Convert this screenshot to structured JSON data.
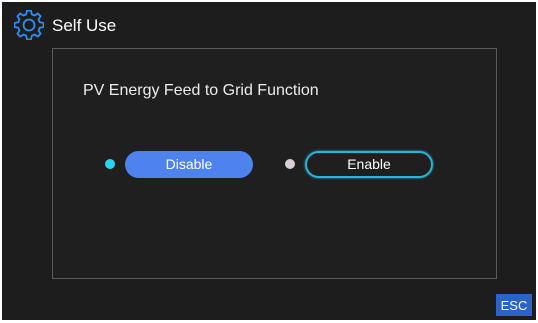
{
  "header": {
    "title": "Self Use",
    "icon": "gear-icon"
  },
  "panel": {
    "heading": "PV Energy Feed to Grid Function",
    "options": [
      {
        "label": "Disable",
        "selected": true
      },
      {
        "label": "Enable",
        "selected": false
      }
    ]
  },
  "footer": {
    "esc_label": "ESC"
  },
  "colors": {
    "background": "#1d1d1d",
    "accent_blue": "#4e82ee",
    "selected_dot": "#27d7ee",
    "unselected_dot": "#d9cdd6",
    "outline": "#28b4d8",
    "esc_button": "#2b64c8",
    "gear": "#2f8ef5"
  }
}
